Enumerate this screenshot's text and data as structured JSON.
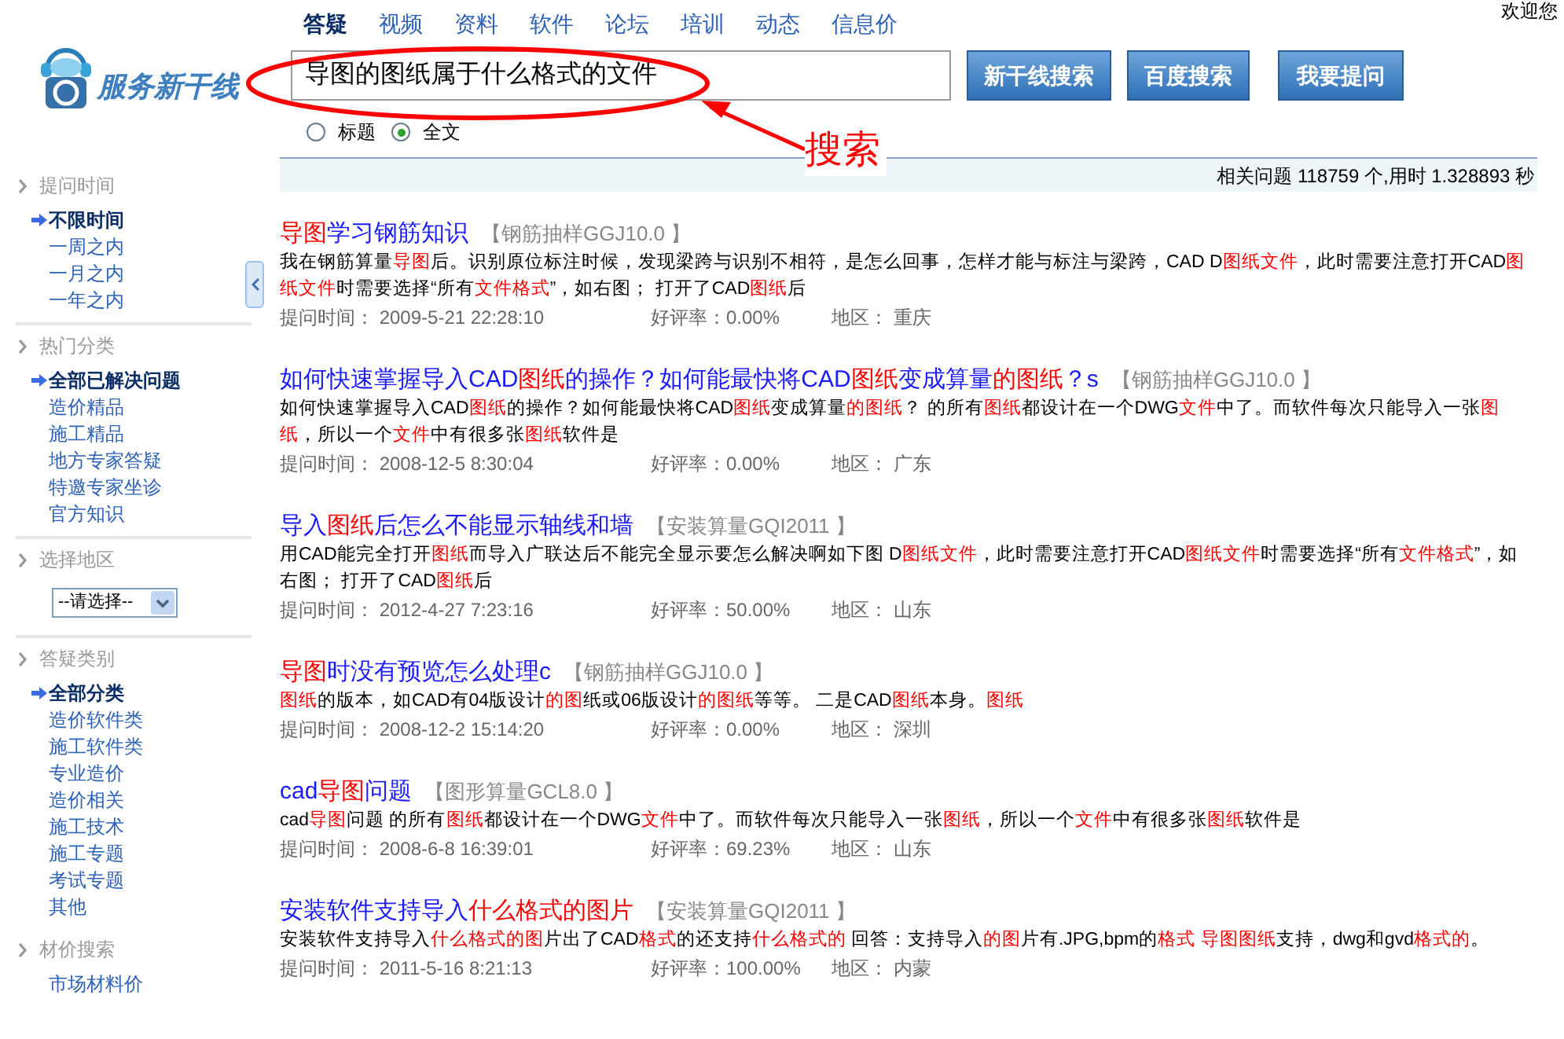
{
  "welcome": "欢迎您",
  "logo": {
    "text": "服务新干线"
  },
  "nav": [
    {
      "label": "答疑",
      "selected": true
    },
    {
      "label": "视频",
      "selected": false
    },
    {
      "label": "资料",
      "selected": false
    },
    {
      "label": "软件",
      "selected": false
    },
    {
      "label": "论坛",
      "selected": false
    },
    {
      "label": "培训",
      "selected": false
    },
    {
      "label": "动态",
      "selected": false
    },
    {
      "label": "信息价",
      "selected": false
    }
  ],
  "search": {
    "value": "导图的图纸属于什么格式的文件",
    "buttons": [
      "新干线搜索",
      "百度搜索",
      "我要提问"
    ],
    "scope": [
      {
        "label": "标题",
        "selected": false
      },
      {
        "label": "全文",
        "selected": true
      }
    ]
  },
  "annotation": {
    "label": "搜索"
  },
  "stats": "相关问题 118759 个,用时 1.328893 秒",
  "sidebar": [
    {
      "heading": "提问时间",
      "items": [
        {
          "kind": "link",
          "label": "不限时间",
          "selected": true
        },
        {
          "kind": "link",
          "label": "一周之内",
          "selected": false
        },
        {
          "kind": "link",
          "label": "一月之内",
          "selected": false
        },
        {
          "kind": "link",
          "label": "一年之内",
          "selected": false
        }
      ]
    },
    {
      "heading": "热门分类",
      "items": [
        {
          "kind": "link",
          "label": "全部已解决问题",
          "selected": true
        },
        {
          "kind": "link",
          "label": "造价精品",
          "selected": false
        },
        {
          "kind": "link",
          "label": "施工精品",
          "selected": false
        },
        {
          "kind": "link",
          "label": "地方专家答疑",
          "selected": false
        },
        {
          "kind": "link",
          "label": "特邀专家坐诊",
          "selected": false
        },
        {
          "kind": "link",
          "label": "官方知识",
          "selected": false
        }
      ]
    },
    {
      "heading": "选择地区",
      "items": [
        {
          "kind": "select",
          "label": "--请选择--"
        }
      ]
    },
    {
      "heading": "答疑类别",
      "items": [
        {
          "kind": "link",
          "label": "全部分类",
          "selected": true
        },
        {
          "kind": "link",
          "label": "造价软件类",
          "selected": false
        },
        {
          "kind": "link",
          "label": "施工软件类",
          "selected": false
        },
        {
          "kind": "link",
          "label": "专业造价",
          "selected": false
        },
        {
          "kind": "link",
          "label": "造价相关",
          "selected": false
        },
        {
          "kind": "link",
          "label": "施工技术",
          "selected": false
        },
        {
          "kind": "link",
          "label": "施工专题",
          "selected": false
        },
        {
          "kind": "link",
          "label": "考试专题",
          "selected": false
        },
        {
          "kind": "link",
          "label": "其他",
          "selected": false
        }
      ]
    },
    {
      "heading": "材价搜索",
      "items": [
        {
          "kind": "link",
          "label": "市场材料价",
          "selected": false
        }
      ]
    }
  ],
  "results": [
    {
      "title": [
        {
          "t": "导图",
          "hl": true
        },
        {
          "t": "学习钢筋知识",
          "hl": false
        }
      ],
      "tag": "【钢筋抽样GGJ10.0 】",
      "snippet": [
        {
          "t": "我在钢筋算量",
          "hl": false
        },
        {
          "t": "导图",
          "hl": true
        },
        {
          "t": "后。识别原位标注时候，发现梁跨与识别不相符，是怎么回事，怎样才能与标注与梁跨，CAD D",
          "hl": false
        },
        {
          "t": "图纸文件",
          "hl": true
        },
        {
          "t": "，此时需要注意打开CAD",
          "hl": false
        },
        {
          "t": "图纸文件",
          "hl": true
        },
        {
          "t": "时需要选择“所有",
          "hl": false
        },
        {
          "t": "文件格式",
          "hl": true
        },
        {
          "t": "”，如右图； 打开了CAD",
          "hl": false
        },
        {
          "t": "图纸",
          "hl": true
        },
        {
          "t": "后",
          "hl": false
        }
      ],
      "time": "提问时间： 2009-5-21 22:28:10",
      "rating": "好评率：0.00%",
      "region": "地区： 重庆"
    },
    {
      "title": [
        {
          "t": "如何快速掌握导入CAD",
          "hl": false
        },
        {
          "t": "图纸",
          "hl": true
        },
        {
          "t": "的操作？如何能最快将CAD",
          "hl": false
        },
        {
          "t": "图纸",
          "hl": true
        },
        {
          "t": "变成算量",
          "hl": false
        },
        {
          "t": "的图纸",
          "hl": true
        },
        {
          "t": "？s",
          "hl": false
        }
      ],
      "tag": "【钢筋抽样GGJ10.0 】",
      "snippet": [
        {
          "t": "如何快速掌握导入CAD",
          "hl": false
        },
        {
          "t": "图纸",
          "hl": true
        },
        {
          "t": "的操作？如何能最快将CAD",
          "hl": false
        },
        {
          "t": "图纸",
          "hl": true
        },
        {
          "t": "变成算量",
          "hl": false
        },
        {
          "t": "的图纸",
          "hl": true
        },
        {
          "t": "？ 的所有",
          "hl": false
        },
        {
          "t": "图纸",
          "hl": true
        },
        {
          "t": "都设计在一个DWG",
          "hl": false
        },
        {
          "t": "文件",
          "hl": true
        },
        {
          "t": "中了。而软件每次只能导入一张",
          "hl": false
        },
        {
          "t": "图纸",
          "hl": true
        },
        {
          "t": "，所以一个",
          "hl": false
        },
        {
          "t": "文件",
          "hl": true
        },
        {
          "t": "中有很多张",
          "hl": false
        },
        {
          "t": "图纸",
          "hl": true
        },
        {
          "t": "软件是",
          "hl": false
        }
      ],
      "time": "提问时间： 2008-12-5 8:30:04",
      "rating": "好评率：0.00%",
      "region": "地区： 广东"
    },
    {
      "title": [
        {
          "t": "导入",
          "hl": false
        },
        {
          "t": "图纸",
          "hl": true
        },
        {
          "t": "后怎么不能显示轴线和墙",
          "hl": false
        }
      ],
      "tag": "【安装算量GQI2011 】",
      "snippet": [
        {
          "t": "用CAD能完全打开",
          "hl": false
        },
        {
          "t": "图纸",
          "hl": true
        },
        {
          "t": "而导入广联达后不能完全显示要怎么解决啊如下图 D",
          "hl": false
        },
        {
          "t": "图纸文件",
          "hl": true
        },
        {
          "t": "，此时需要注意打开CAD",
          "hl": false
        },
        {
          "t": "图纸文件",
          "hl": true
        },
        {
          "t": "时需要选择“所有",
          "hl": false
        },
        {
          "t": "文件格式",
          "hl": true
        },
        {
          "t": "”，如右图； 打开了CAD",
          "hl": false
        },
        {
          "t": "图纸",
          "hl": true
        },
        {
          "t": "后",
          "hl": false
        }
      ],
      "time": "提问时间： 2012-4-27 7:23:16",
      "rating": "好评率：50.00%",
      "region": "地区： 山东"
    },
    {
      "title": [
        {
          "t": "导图",
          "hl": true
        },
        {
          "t": "时没有预览怎么处理c",
          "hl": false
        }
      ],
      "tag": "【钢筋抽样GGJ10.0 】",
      "snippet": [
        {
          "t": "图纸",
          "hl": true
        },
        {
          "t": "的版本，如CAD有04版设计",
          "hl": false
        },
        {
          "t": "的图",
          "hl": true
        },
        {
          "t": "纸或06版设计",
          "hl": false
        },
        {
          "t": "的图纸",
          "hl": true
        },
        {
          "t": "等等。 二是CAD",
          "hl": false
        },
        {
          "t": "图纸",
          "hl": true
        },
        {
          "t": "本身。",
          "hl": false
        },
        {
          "t": "图纸",
          "hl": true
        }
      ],
      "time": "提问时间： 2008-12-2 15:14:20",
      "rating": "好评率：0.00%",
      "region": "地区： 深圳"
    },
    {
      "title": [
        {
          "t": "cad",
          "hl": false
        },
        {
          "t": "导图",
          "hl": true
        },
        {
          "t": "问题",
          "hl": false
        }
      ],
      "tag": "【图形算量GCL8.0 】",
      "snippet": [
        {
          "t": "cad",
          "hl": false
        },
        {
          "t": "导图",
          "hl": true
        },
        {
          "t": "问题 的所有",
          "hl": false
        },
        {
          "t": "图纸",
          "hl": true
        },
        {
          "t": "都设计在一个DWG",
          "hl": false
        },
        {
          "t": "文件",
          "hl": true
        },
        {
          "t": "中了。而软件每次只能导入一张",
          "hl": false
        },
        {
          "t": "图纸",
          "hl": true
        },
        {
          "t": "，所以一个",
          "hl": false
        },
        {
          "t": "文件",
          "hl": true
        },
        {
          "t": "中有很多张",
          "hl": false
        },
        {
          "t": "图纸",
          "hl": true
        },
        {
          "t": "软件是",
          "hl": false
        }
      ],
      "time": "提问时间： 2008-6-8 16:39:01",
      "rating": "好评率：69.23%",
      "region": "地区： 山东"
    },
    {
      "title": [
        {
          "t": "安装软件支持导入",
          "hl": false
        },
        {
          "t": "什么格式的图片",
          "hl": true
        }
      ],
      "tag": "【安装算量GQI2011 】",
      "snippet": [
        {
          "t": "安装软件支持导入",
          "hl": false
        },
        {
          "t": "什么格式的图",
          "hl": true
        },
        {
          "t": "片出了CAD",
          "hl": false
        },
        {
          "t": "格式",
          "hl": true
        },
        {
          "t": "的还支持",
          "hl": false
        },
        {
          "t": "什么格式的",
          "hl": true
        },
        {
          "t": " 回答：支持导入",
          "hl": false
        },
        {
          "t": "的图",
          "hl": true
        },
        {
          "t": "片有.JPG,bpm的",
          "hl": false
        },
        {
          "t": "格式 导图图纸",
          "hl": true
        },
        {
          "t": "支持，dwg和gvd",
          "hl": false
        },
        {
          "t": "格式的",
          "hl": true
        },
        {
          "t": "。",
          "hl": false
        }
      ],
      "time": "提问时间： 2011-5-16 8:21:13",
      "rating": "好评率：100.00%",
      "region": "地区： 内蒙"
    }
  ]
}
